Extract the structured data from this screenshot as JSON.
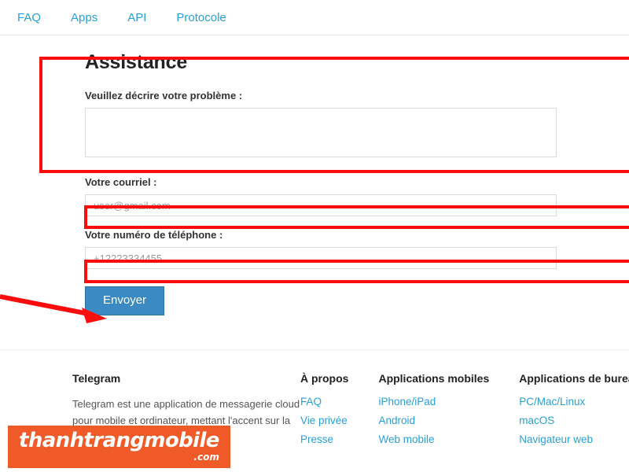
{
  "nav": {
    "items": [
      {
        "label": "FAQ"
      },
      {
        "label": "Apps"
      },
      {
        "label": "API"
      },
      {
        "label": "Protocole"
      }
    ]
  },
  "form": {
    "title": "Assistance",
    "problem": {
      "label": "Veuillez décrire votre problème :",
      "value": "",
      "placeholder": ""
    },
    "email": {
      "label": "Votre courriel :",
      "value": "",
      "placeholder": "user@gmail.com"
    },
    "phone": {
      "label": "Votre numéro de téléphone :",
      "value": "",
      "placeholder": "+12223334455"
    },
    "submit_label": "Envoyer"
  },
  "footer": {
    "about": {
      "heading": "Telegram",
      "description": "Telegram est une application de messagerie cloud pour mobile et ordinateur, mettant l'accent sur la sécurité et la rapidité."
    },
    "columns": [
      {
        "heading": "À propos",
        "links": [
          {
            "label": "FAQ"
          },
          {
            "label": "Vie privée"
          },
          {
            "label": "Presse"
          }
        ]
      },
      {
        "heading": "Applications mobiles",
        "links": [
          {
            "label": "iPhone/iPad"
          },
          {
            "label": "Android"
          },
          {
            "label": "Web mobile"
          }
        ]
      },
      {
        "heading": "Applications de bureau",
        "links": [
          {
            "label": "PC/Mac/Linux"
          },
          {
            "label": "macOS"
          },
          {
            "label": "Navigateur web"
          }
        ]
      }
    ]
  },
  "watermark": {
    "main": "thanhtrangmobile",
    "suffix": ".com"
  },
  "colors": {
    "link_blue": "#2a9fd8",
    "button_blue": "#3b8ac4",
    "annotation_red": "#fb0d0d",
    "watermark_orange": "#f05a28"
  }
}
